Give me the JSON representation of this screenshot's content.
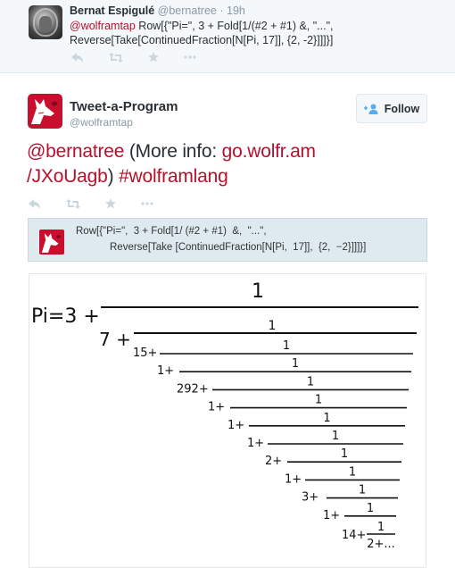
{
  "parent_tweet": {
    "author_name": "Bernat Espigulé",
    "author_handle": "@bernatree",
    "separator": "·",
    "timestamp": "19h",
    "mention": "@wolframtap",
    "text_line1": " Row[{\"Pi=\", 3 + Fold[1/(#2 + #1) &, \"...\",",
    "text_line2": "Reverse[Take[ContinuedFraction[N[Pi, 17]], {2, -2}]]]}]",
    "actions": [
      "reply-icon",
      "retweet-icon",
      "favorite-icon",
      "more-icon"
    ]
  },
  "main_tweet": {
    "author_name": "Tweet-a-Program",
    "author_handle": "@wolframtap",
    "follow_label": "Follow",
    "text": {
      "mention": "@bernatree",
      "plain1": " (More info: ",
      "link_part1": "go.wolfr.am",
      "link_part2": "/JXoUagb",
      "plain2": ") ",
      "hashtag": "#wolframlang"
    },
    "actions": [
      "reply-icon",
      "retweet-icon",
      "favorite-icon",
      "more-icon"
    ]
  },
  "code": {
    "line1": "Row[{\"Pi=\",  3 + Fold[1/ (#2 + #1)  &,  \"...\",",
    "line2": "Reverse[Take [ContinuedFraction[N[Pi,  17]],  {2,  −2}]]]}]"
  },
  "output": {
    "prefix": "Pi=3 +",
    "numerator": "1",
    "terms": [
      "7",
      "15",
      "1",
      "292",
      "1",
      "1",
      "1",
      "2",
      "1",
      "3",
      "1",
      "14"
    ],
    "tail": "2+..."
  },
  "colors": {
    "mention": "#b7102c",
    "handle": "#8899a6",
    "follow_icon": "#55acee",
    "wolfram_red": "#c8102e"
  }
}
